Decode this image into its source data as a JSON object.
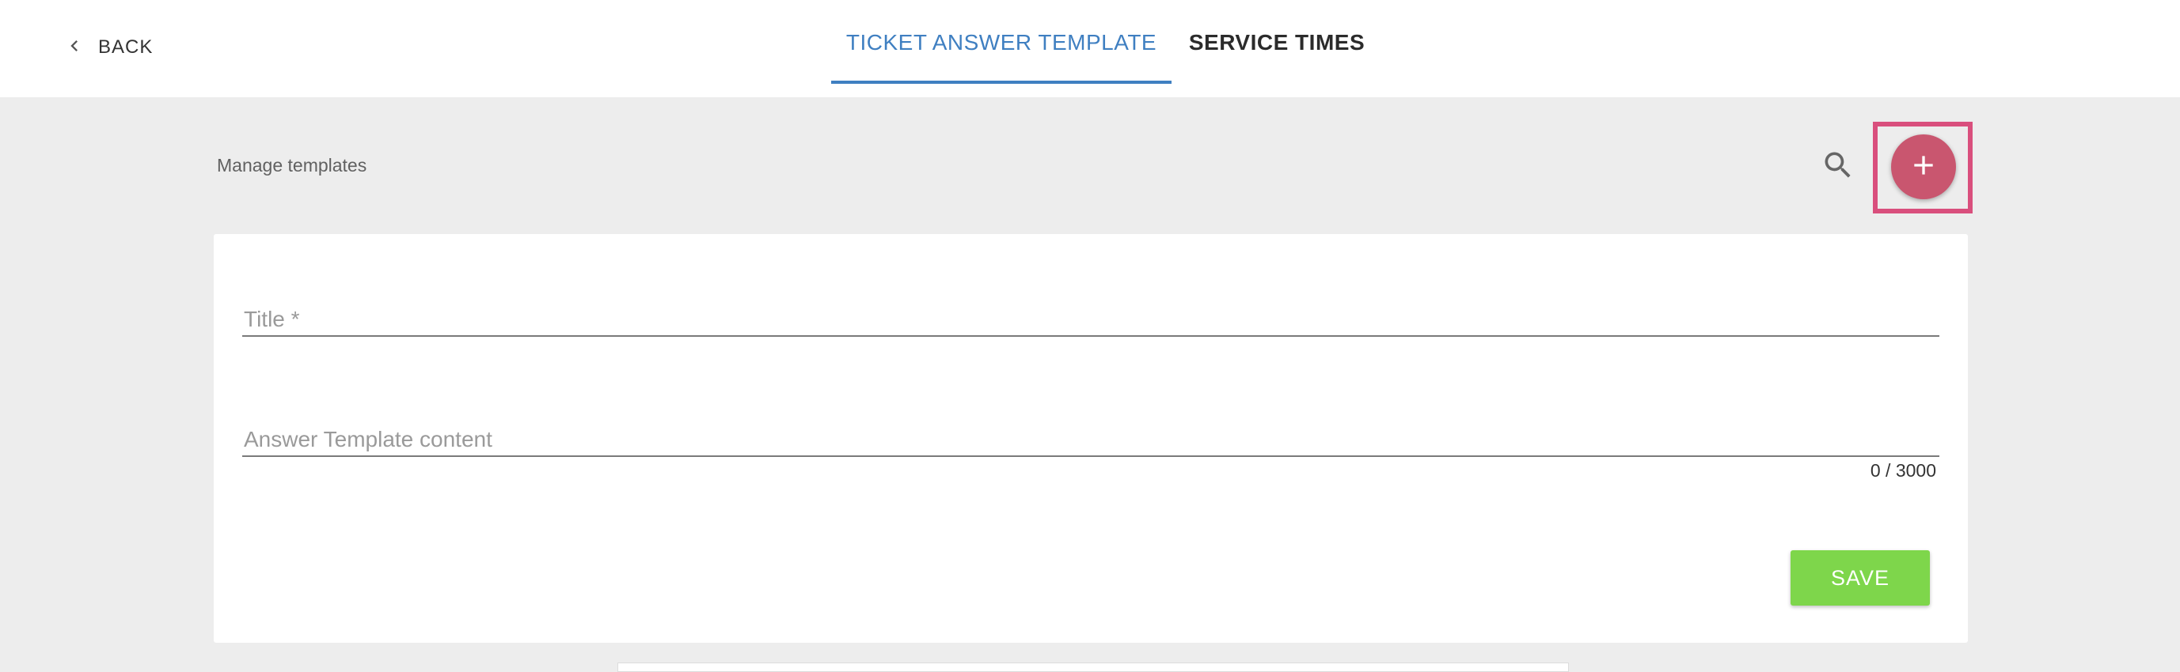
{
  "header": {
    "back_label": "BACK",
    "tabs": [
      {
        "label": "TICKET ANSWER TEMPLATE",
        "active": true
      },
      {
        "label": "SERVICE TIMES",
        "active": false
      }
    ],
    "accent_color": "#3f7fc1"
  },
  "toolbar": {
    "title": "Manage templates",
    "search_icon": "search-icon",
    "add_icon": "plus-icon",
    "add_button_color": "#c9566f"
  },
  "form": {
    "title_placeholder": "Title *",
    "content_placeholder": "Answer Template content",
    "char_counter": "0 / 3000",
    "save_label": "SAVE",
    "save_color": "#7ed64b"
  }
}
